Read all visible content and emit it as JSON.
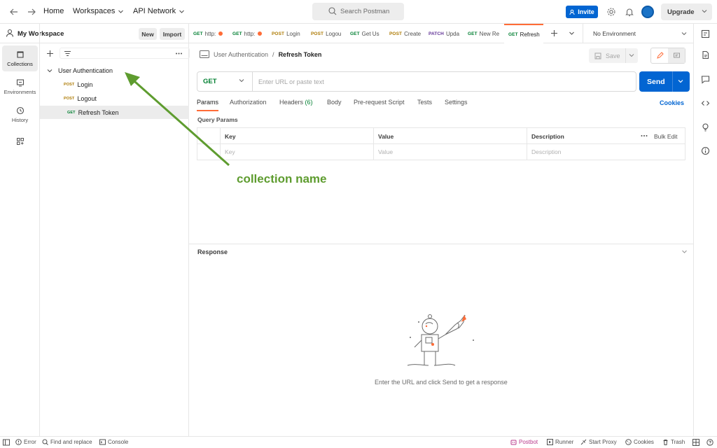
{
  "topbar": {
    "home": "Home",
    "workspaces": "Workspaces",
    "api_network": "API Network",
    "search_placeholder": "Search Postman",
    "invite": "Invite",
    "upgrade": "Upgrade"
  },
  "workspace": {
    "title": "My Workspace",
    "new_label": "New",
    "import_label": "Import"
  },
  "rail": [
    {
      "label": "Collections",
      "icon": "collections-icon"
    },
    {
      "label": "Environments",
      "icon": "environments-icon"
    },
    {
      "label": "History",
      "icon": "history-icon"
    }
  ],
  "tree": {
    "collection": "User Authentication",
    "items": [
      {
        "method": "POST",
        "label": "Login"
      },
      {
        "method": "POST",
        "label": "Logout"
      },
      {
        "method": "GET",
        "label": "Refresh Token"
      }
    ]
  },
  "tabs": [
    {
      "method": "GET",
      "label": "http:",
      "unsaved": true
    },
    {
      "method": "GET",
      "label": "http:",
      "unsaved": true
    },
    {
      "method": "POST",
      "label": "Login",
      "unsaved": false
    },
    {
      "method": "POST",
      "label": "Logou",
      "unsaved": false
    },
    {
      "method": "GET",
      "label": "Get Us",
      "unsaved": false
    },
    {
      "method": "POST",
      "label": "Create",
      "unsaved": false
    },
    {
      "method": "PATCH",
      "label": "Upda",
      "unsaved": false
    },
    {
      "method": "GET",
      "label": "New Re",
      "unsaved": false
    },
    {
      "method": "GET",
      "label": "Refresh",
      "unsaved": false
    }
  ],
  "environment": "No Environment",
  "request": {
    "breadcrumb_parent": "User Authentication",
    "breadcrumb_sep": "/",
    "breadcrumb_current": "Refresh Token",
    "save_label": "Save",
    "method": "GET",
    "url_placeholder": "Enter URL or paste text",
    "send_label": "Send",
    "tabs": {
      "params": "Params",
      "authorization": "Authorization",
      "headers": "Headers",
      "headers_count": "(6)",
      "body": "Body",
      "prerequest": "Pre-request Script",
      "tests": "Tests",
      "settings": "Settings"
    },
    "cookies": "Cookies",
    "query_params_title": "Query Params",
    "table": {
      "key": "Key",
      "value": "Value",
      "description": "Description",
      "bulk_edit": "Bulk Edit",
      "key_ph": "Key",
      "value_ph": "Value",
      "description_ph": "Description"
    }
  },
  "annotation": {
    "text": "collection name",
    "color": "#5e9c2f"
  },
  "response": {
    "title": "Response",
    "empty_text": "Enter the URL and click Send to get a response"
  },
  "statusbar": {
    "error": "Error",
    "find_replace": "Find and replace",
    "console": "Console",
    "postbot": "Postbot",
    "runner": "Runner",
    "start_proxy": "Start Proxy",
    "cookies": "Cookies",
    "trash": "Trash"
  },
  "colors": {
    "accent": "#ff6c37",
    "primary": "#0265d2",
    "get": "#007f31",
    "post": "#ad7a03",
    "patch": "#623497"
  }
}
